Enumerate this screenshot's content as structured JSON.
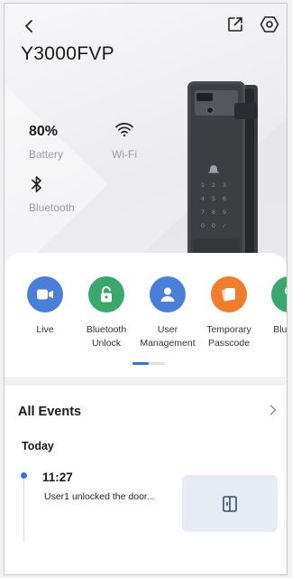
{
  "header": {
    "device_name": "Y3000FVP"
  },
  "status": {
    "battery_value": "80%",
    "battery_label": "Battery",
    "wifi_label": "Wi-Fi",
    "bluetooth_label": "Bluetooth"
  },
  "shortcuts": [
    {
      "line1": "Live",
      "line2": "",
      "icon": "video-camera-icon",
      "color": "#4a7fd8"
    },
    {
      "line1": "Bluetooth",
      "line2": "Unlock",
      "icon": "padlock-icon",
      "color": "#3aa86d"
    },
    {
      "line1": "User",
      "line2": "Management",
      "icon": "user-icon",
      "color": "#4a7fd8"
    },
    {
      "line1": "Temporary",
      "line2": "Passcode",
      "icon": "passcode-card-icon",
      "color": "#f07d2e"
    },
    {
      "line1": "Bluetoo",
      "line2": "",
      "icon": "key-icon",
      "color": "#3aa86d"
    }
  ],
  "events": {
    "title": "All Events",
    "group_label": "Today",
    "items": [
      {
        "time": "11:27",
        "user": "User1",
        "text": "unlocked the door..."
      }
    ]
  },
  "colors": {
    "accent": "#3b6fd9",
    "thumbnail_bg": "#e6ebf4"
  }
}
